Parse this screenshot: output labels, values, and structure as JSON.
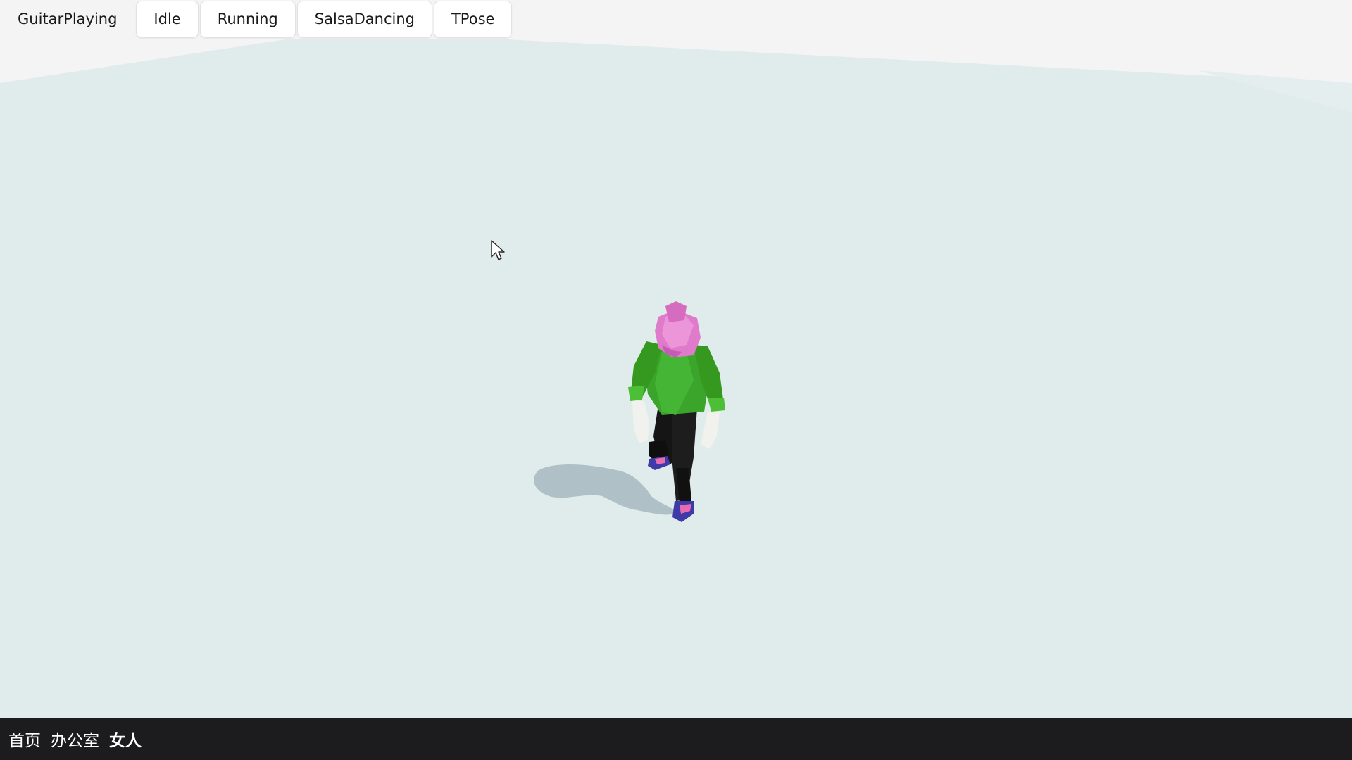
{
  "toolbar": {
    "animations": [
      {
        "label": "GuitarPlaying",
        "active": true
      },
      {
        "label": "Idle",
        "active": false
      },
      {
        "label": "Running",
        "active": false
      },
      {
        "label": "SalsaDancing",
        "active": false
      },
      {
        "label": "TPose",
        "active": false
      }
    ]
  },
  "scene": {
    "ground_color": "#e0ebeb",
    "background_color": "#f4f4f4",
    "shadow_color": "#aabdc3",
    "character": {
      "hair_color": "#e07acb",
      "shirt_color": "#3aa52a",
      "pants_color": "#151515",
      "skin_color": "#f1f1ee",
      "shoe_color": "#3e3aa8"
    }
  },
  "bottom_nav": {
    "items": [
      {
        "label": "首页"
      },
      {
        "label": "办公室"
      },
      {
        "label": "女人"
      }
    ]
  }
}
